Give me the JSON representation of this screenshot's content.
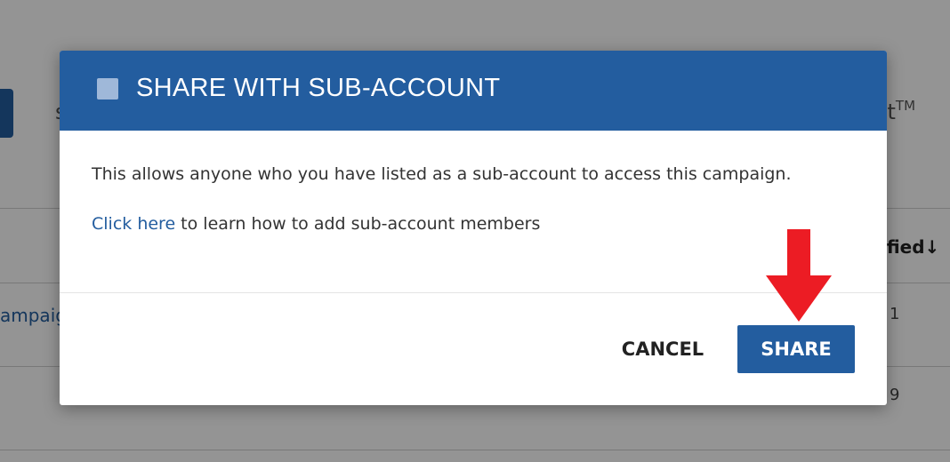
{
  "background": {
    "fragment_left": "s",
    "fragment_right": "st",
    "fragment_right_sup": "TM",
    "column_header": "ified↓",
    "row_link": "ampaig",
    "row1_value": "1",
    "row2_value": "9"
  },
  "modal": {
    "title": "SHARE WITH SUB-ACCOUNT",
    "description": "This allows anyone who you have listed as a sub-account to access this campaign.",
    "help_link_text": "Click here",
    "help_suffix": " to learn how to add sub-account members",
    "cancel_label": "CANCEL",
    "share_label": "SHARE"
  },
  "colors": {
    "brand_blue": "#235d9f",
    "annotation_red": "#ec1c24"
  },
  "icons": {
    "header_icon": "checkbox-icon",
    "annotation": "arrow-down-icon"
  }
}
